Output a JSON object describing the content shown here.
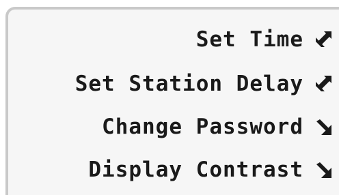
{
  "menu": {
    "items": [
      {
        "label": "Set Time",
        "icon": "arrow-up-right-icon"
      },
      {
        "label": "Set Station Delay",
        "icon": "arrow-up-right-icon"
      },
      {
        "label": "Change Password",
        "icon": "arrow-down-right-icon"
      },
      {
        "label": "Display Contrast",
        "icon": "arrow-down-right-icon"
      }
    ]
  },
  "colors": {
    "text": "#1a1a1a",
    "panel": "#f6f6f6",
    "border": "#c9c9c9"
  }
}
